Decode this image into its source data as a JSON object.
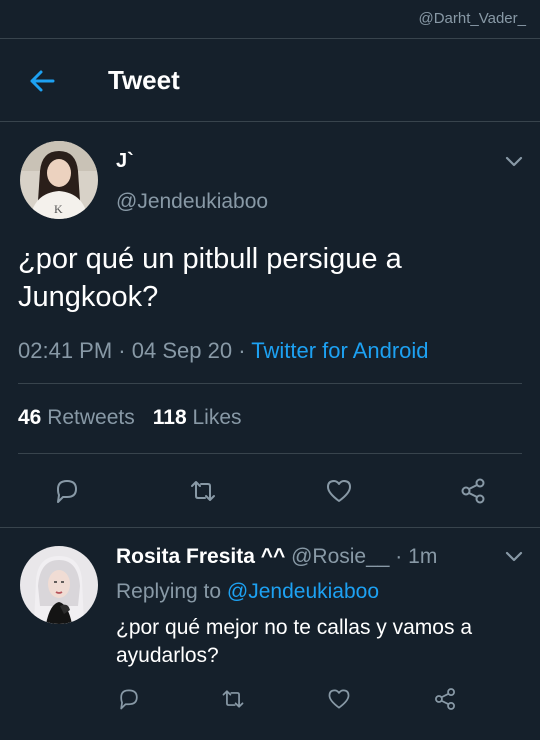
{
  "watermark": "@Darht_Vader_",
  "header": {
    "title": "Tweet"
  },
  "tweet": {
    "author_name": "J`",
    "author_handle": "@Jendeukiaboo",
    "text": "¿por qué un pitbull persigue a Jungkook?",
    "time": "02:41 PM",
    "date": "04 Sep 20",
    "source": "Twitter for Android",
    "retweets_count": "46",
    "retweets_label": "Retweets",
    "likes_count": "118",
    "likes_label": "Likes"
  },
  "reply": {
    "author_name": "Rosita Fresita ^^",
    "author_handle": "@Rosie__",
    "age": "1m",
    "replying_prefix": "Replying to",
    "replying_to": "@Jendeukiaboo",
    "text": "¿por qué mejor no te callas y vamos a ayudarlos?"
  },
  "colors": {
    "background": "#15202b",
    "accent": "#1da1f2",
    "secondary_text": "#8899a6",
    "divider": "#38444d"
  },
  "icons": [
    "back-arrow-icon",
    "chevron-down-icon",
    "reply-icon",
    "retweet-icon",
    "like-icon",
    "share-icon"
  ]
}
